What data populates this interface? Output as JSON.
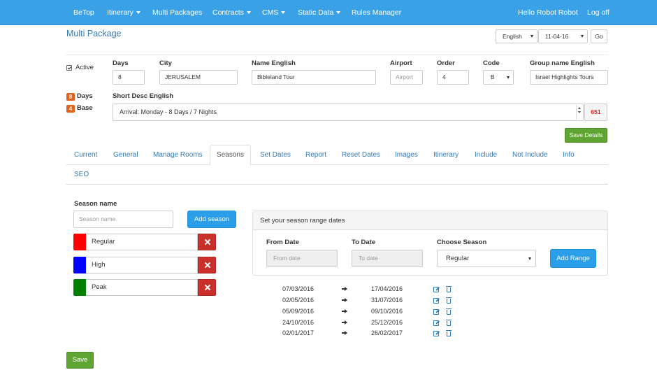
{
  "nav": {
    "brand": "BeTop",
    "itinerary": "Itinerary",
    "multi_packages": "Multi Packages",
    "contracts": "Contracts",
    "cms": "CMS",
    "static_data": "Static Data",
    "rules_manager": "Rules Manager",
    "greeting": "Hello Robot Robot",
    "logout": "Log off"
  },
  "page": {
    "title": "Multi Package",
    "language": "English",
    "date": "11-04-16",
    "go": "Go"
  },
  "form": {
    "active_label": "Active",
    "days_label": "Days",
    "days_value": "8",
    "city_label": "City",
    "city_value": "JERUSALEM",
    "name_label": "Name English",
    "name_value": "Bibleland Tour",
    "airport_label": "Airport",
    "airport_placeholder": "Airport",
    "order_label": "Order",
    "order_value": "4",
    "code_label": "Code",
    "code_value": "B",
    "group_label": "Group name English",
    "group_value": "Israel Highlights Tours",
    "badge_days_num": "8",
    "badge_days_text": "Days",
    "badge_base_num": "4",
    "badge_base_text": "Base",
    "short_desc_label": "Short Desc English",
    "short_desc_value": "Arrival: Monday - 8 Days / 7 Nights",
    "char_counter": "651",
    "save_details": "Save Details"
  },
  "tabs": [
    "Current",
    "General",
    "Manage Rooms",
    "Seasons",
    "Set Dates",
    "Report",
    "Reset Dates",
    "Images",
    "Itinerary",
    "Include",
    "Not Include",
    "Info",
    "SEO"
  ],
  "seasons": {
    "label": "Season name",
    "input_placeholder": "Season name",
    "add_button": "Add season",
    "items": [
      {
        "name": "Regular",
        "color": "#ff0000"
      },
      {
        "name": "High",
        "color": "#0000ff"
      },
      {
        "name": "Peak",
        "color": "#008000"
      }
    ]
  },
  "range_panel": {
    "heading": "Set your season range dates",
    "from_label": "From Date",
    "from_placeholder": "From date",
    "to_label": "To Date",
    "to_placeholder": "To date",
    "choose_label": "Choose Season",
    "choose_value": "Regular",
    "add_button": "Add Range"
  },
  "ranges": [
    {
      "from": "07/03/2016",
      "to": "17/04/2016"
    },
    {
      "from": "02/05/2016",
      "to": "31/07/2016"
    },
    {
      "from": "05/09/2016",
      "to": "09/10/2016"
    },
    {
      "from": "24/10/2016",
      "to": "25/12/2016"
    },
    {
      "from": "02/01/2017",
      "to": "26/02/2017"
    }
  ],
  "footer": {
    "save": "Save"
  }
}
